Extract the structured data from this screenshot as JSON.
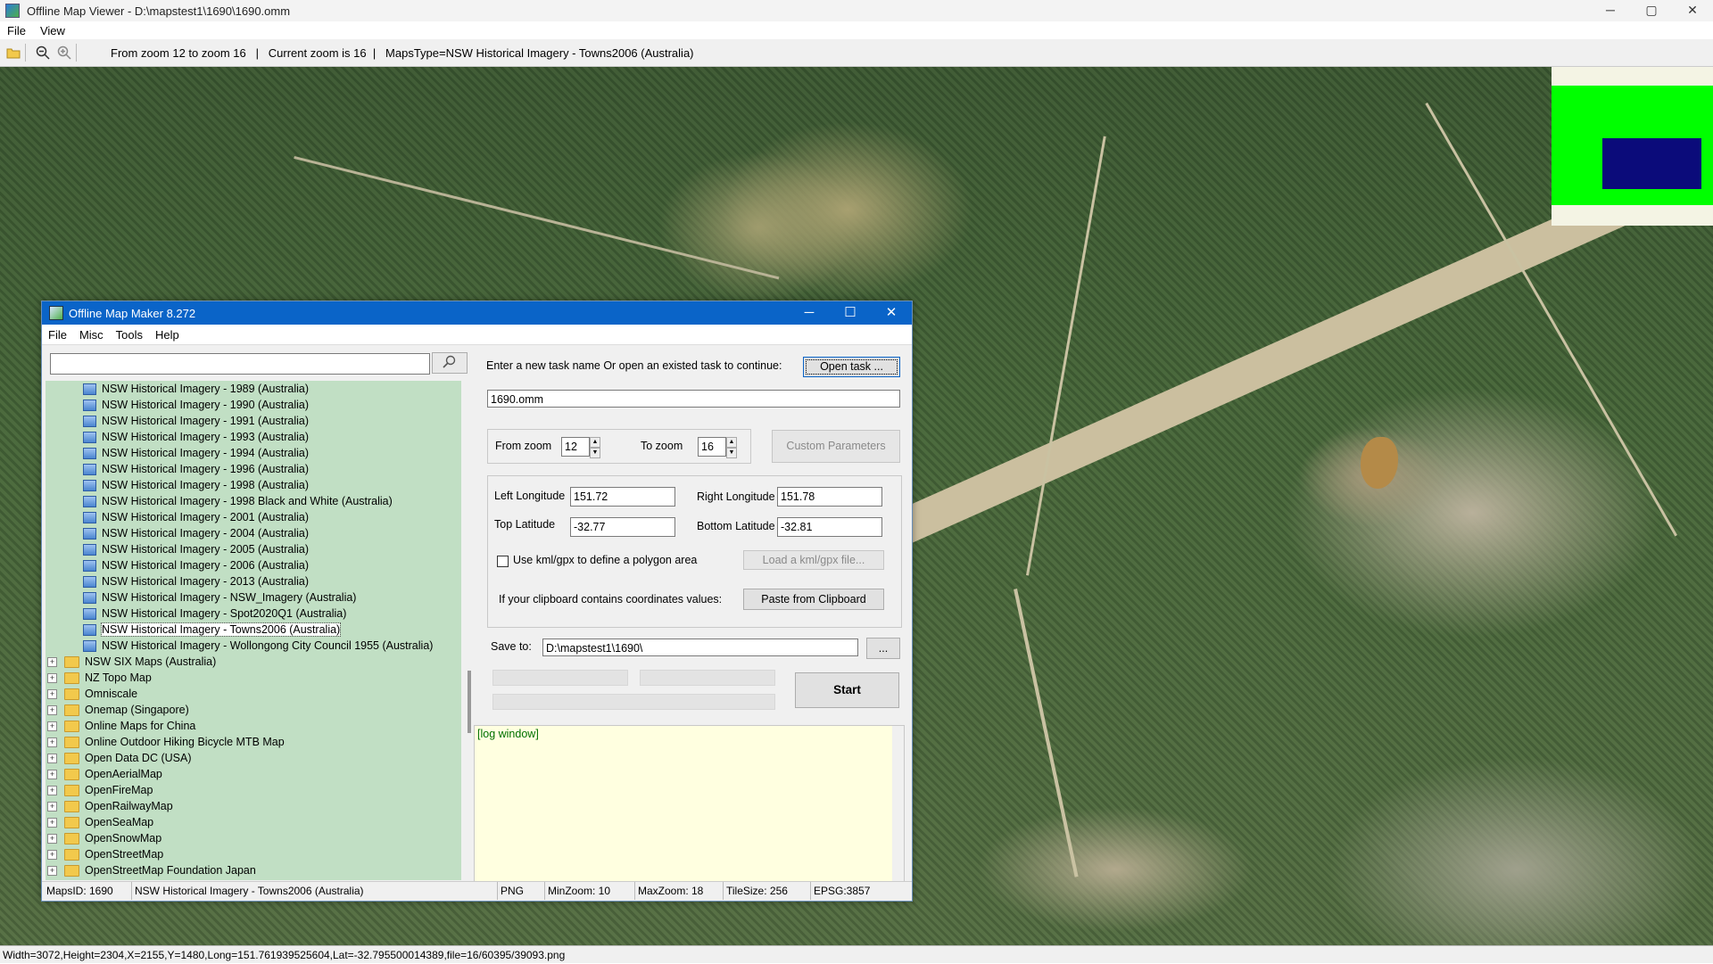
{
  "window": {
    "title": "Offline Map Viewer - D:\\mapstest1\\1690\\1690.omm",
    "controls": [
      "─",
      "▢",
      "✕"
    ]
  },
  "menu": [
    "File",
    "View"
  ],
  "toolbar": {
    "info": "From zoom 12 to zoom 16   |   Current zoom is 16  |   MapsType=NSW Historical Imagery - Towns2006 (Australia)"
  },
  "statusbar": {
    "text": "Width=3072,Height=2304,X=2155,Y=1480,Long=151.761939525604,Lat=-32.795500014389,file=16/60395/39093.png"
  },
  "colors": {
    "overview_bg": "#00ff00",
    "overview_view": "#0b0b7a",
    "title_blue": "#0a64c8",
    "tree_bg": "#c1dfc4"
  },
  "dialog": {
    "title": "Offline Map Maker 8.272",
    "controls": [
      "─",
      "☐",
      "✕"
    ],
    "menu": [
      "File",
      "Misc",
      "Tools",
      "Help"
    ],
    "search": {
      "value": "",
      "placeholder": ""
    },
    "tree": {
      "children": [
        "NSW Historical Imagery - 1989 (Australia)",
        "NSW Historical Imagery - 1990 (Australia)",
        "NSW Historical Imagery - 1991 (Australia)",
        "NSW Historical Imagery - 1993 (Australia)",
        "NSW Historical Imagery - 1994 (Australia)",
        "NSW Historical Imagery - 1996 (Australia)",
        "NSW Historical Imagery - 1998 (Australia)",
        "NSW Historical Imagery - 1998 Black and White (Australia)",
        "NSW Historical Imagery - 2001 (Australia)",
        "NSW Historical Imagery - 2004 (Australia)",
        "NSW Historical Imagery - 2005 (Australia)",
        "NSW Historical Imagery - 2006 (Australia)",
        "NSW Historical Imagery - 2013 (Australia)",
        "NSW Historical Imagery - NSW_Imagery (Australia)",
        "NSW Historical Imagery - Spot2020Q1 (Australia)",
        "NSW Historical Imagery - Towns2006 (Australia)",
        "NSW Historical Imagery - Wollongong City Council 1955 (Australia)"
      ],
      "selected": "NSW Historical Imagery - Towns2006 (Australia)",
      "folders": [
        "NSW SIX Maps (Australia)",
        "NZ Topo Map",
        "Omniscale",
        "Onemap (Singapore)",
        "Online Maps for China",
        "Online Outdoor Hiking Bicycle MTB Map",
        "Open Data DC (USA)",
        "OpenAerialMap",
        "OpenFireMap",
        "OpenRailwayMap",
        "OpenSeaMap",
        "OpenSnowMap",
        "OpenStreetMap",
        "OpenStreetMap Foundation Japan"
      ]
    },
    "task_prompt": "Enter a new task name Or open an existed task to continue:",
    "open_task": "Open task ...",
    "task_name": "1690.omm",
    "from_zoom_label": "From zoom",
    "from_zoom": "12",
    "to_zoom_label": "To zoom",
    "to_zoom": "16",
    "custom_params": "Custom Parameters",
    "left_lon_label": "Left Longitude",
    "left_lon": "151.72",
    "right_lon_label": "Right Longitude",
    "right_lon": "151.78",
    "top_lat_label": "Top Latitude",
    "top_lat": "-32.77",
    "bottom_lat_label": "Bottom Latitude",
    "bottom_lat": "-32.81",
    "kml_label": "Use kml/gpx to define a polygon area",
    "kml_button": "Load a kml/gpx file...",
    "clipboard_label": "If your clipboard contains coordinates values:",
    "clipboard_button": "Paste from Clipboard",
    "save_label": "Save to:",
    "save_path": "D:\\mapstest1\\1690\\",
    "browse": "...",
    "start": "Start",
    "log": "[log window]",
    "status": {
      "maps_id": "MapsID: 1690",
      "maps_name": "NSW Historical Imagery - Towns2006 (Australia)",
      "format": "PNG",
      "min_zoom": "MinZoom: 10",
      "max_zoom": "MaxZoom: 18",
      "tile_size": "TileSize: 256",
      "epsg": "EPSG:3857"
    }
  }
}
